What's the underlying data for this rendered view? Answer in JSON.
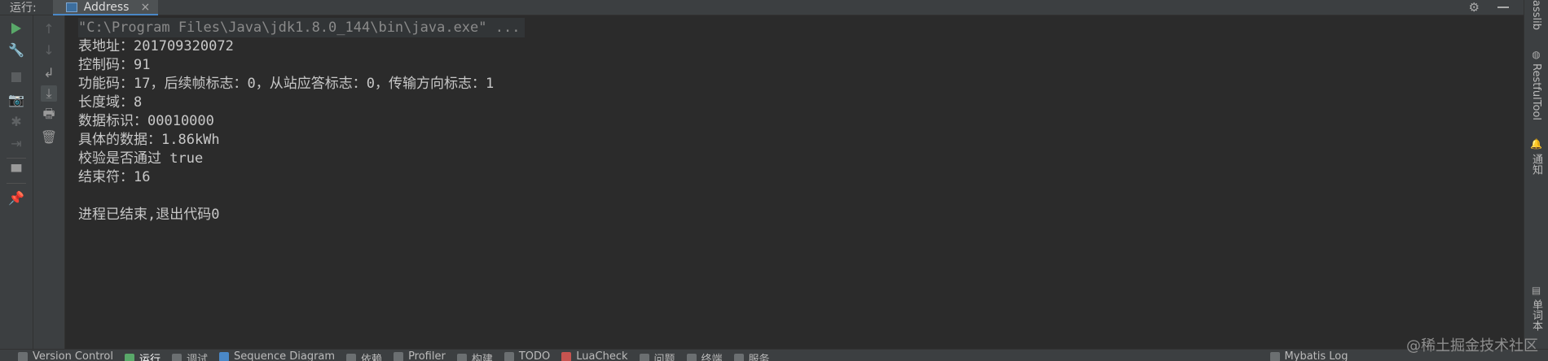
{
  "top_bar": {
    "run_label": "运行:",
    "tab_title": "Address",
    "tab_close": "×",
    "settings_glyph": "⚙"
  },
  "console": {
    "lines": [
      "\"C:\\Program Files\\Java\\jdk1.8.0_144\\bin\\java.exe\" ...",
      "表地址：201709320072",
      "控制码：91",
      "功能码：17，后续帧标志：0，从站应答标志：0，传输方向标志：1",
      "长度域：8",
      "数据标识：00010000",
      "具体的数据：1.86kWh",
      "校验是否通过 true",
      "结束符：16",
      "",
      "进程已结束,退出代码0"
    ]
  },
  "right_strip": {
    "items": [
      "asslib",
      "RestfulTool",
      "通知",
      "单词本"
    ]
  },
  "bottom_bar": {
    "items": [
      "Version Control",
      "运行",
      "调试",
      "Sequence Diagram",
      "依赖",
      "Profiler",
      "构建",
      "TODO",
      "LuaCheck",
      "问题",
      "终端",
      "服务",
      "Mybatis Log"
    ]
  },
  "watermark": "@稀土掘金技术社区"
}
